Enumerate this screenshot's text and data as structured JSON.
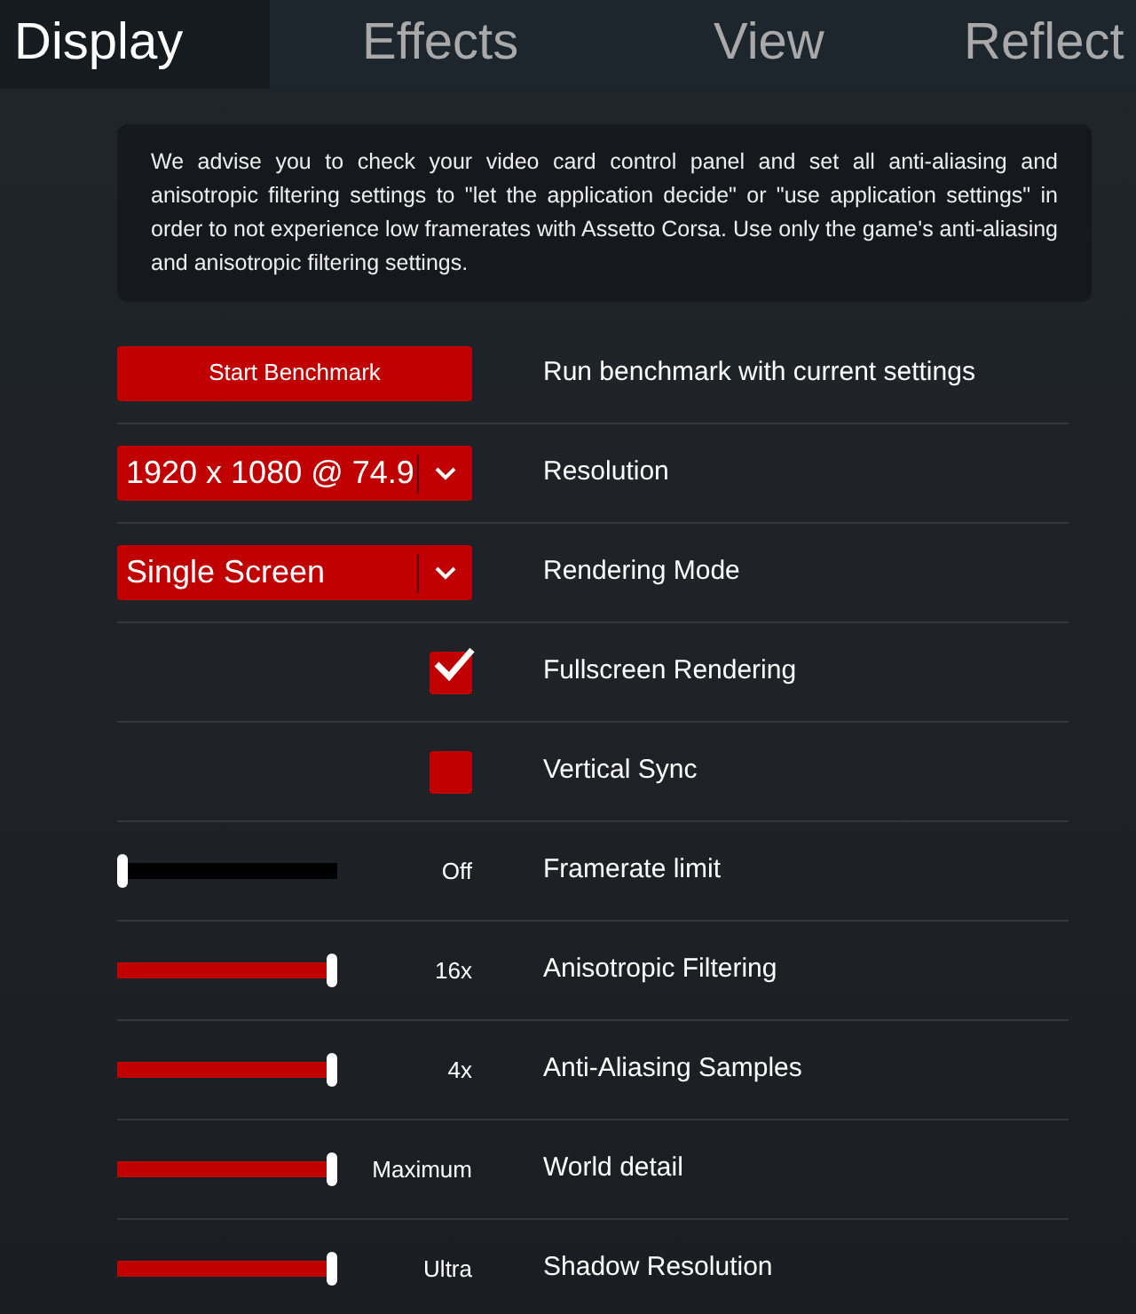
{
  "tabs": [
    {
      "label": "Display",
      "selected": true
    },
    {
      "label": "Effects",
      "selected": false
    },
    {
      "label": "View",
      "selected": false
    },
    {
      "label": "Reflect",
      "selected": false
    }
  ],
  "notice": "We advise you to check your video card control panel and set all anti-aliasing and anisotropic filtering settings to \"let the application decide\" or \"use application settings\" in order to not experience low framerates with Assetto Corsa. Use only the game's anti-aliasing and anisotropic filtering settings.",
  "settings": [
    {
      "kind": "button",
      "button": "Start Benchmark",
      "label": "Run benchmark with current settings"
    },
    {
      "kind": "dropdown",
      "value": "1920 x 1080 @ 74.9",
      "label": "Resolution"
    },
    {
      "kind": "dropdown",
      "value": "Single Screen",
      "label": "Rendering Mode"
    },
    {
      "kind": "checkbox",
      "checked": true,
      "label": "Fullscreen Rendering"
    },
    {
      "kind": "checkbox",
      "checked": false,
      "label": "Vertical Sync"
    },
    {
      "kind": "slider",
      "level": 0,
      "reading": "Off",
      "label": "Framerate limit"
    },
    {
      "kind": "slider",
      "level": 1,
      "reading": "16x",
      "label": "Anisotropic Filtering"
    },
    {
      "kind": "slider",
      "level": 1,
      "reading": "4x",
      "label": "Anti-Aliasing Samples"
    },
    {
      "kind": "slider",
      "level": 1,
      "reading": "Maximum",
      "label": "World detail"
    },
    {
      "kind": "slider",
      "level": 1,
      "reading": "Ultra",
      "label": "Shadow Resolution"
    }
  ]
}
